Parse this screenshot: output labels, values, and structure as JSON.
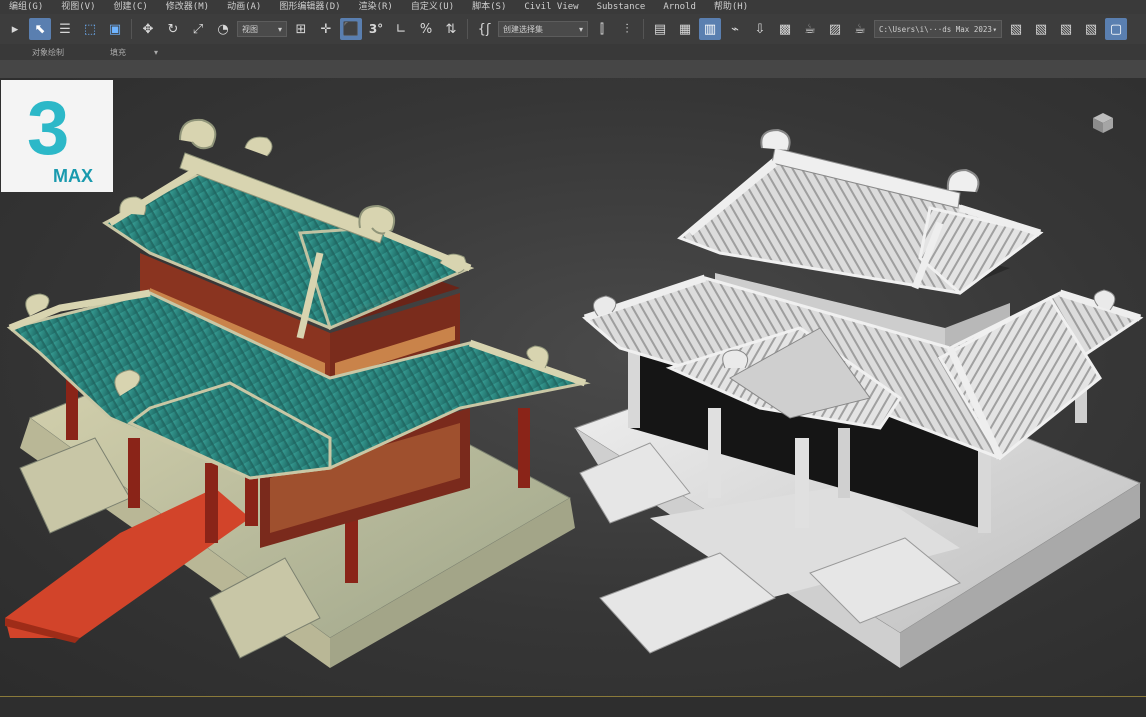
{
  "menu": {
    "items": [
      "编组(G)",
      "视图(V)",
      "创建(C)",
      "修改器(M)",
      "动画(A)",
      "图形编辑器(D)",
      "渲染(R)",
      "自定义(U)",
      "脚本(S)",
      "Civil View",
      "Substance",
      "Arnold",
      "帮助(H)"
    ]
  },
  "toolbar": {
    "view_dropdown": "视图",
    "selection_set_dropdown": "创建选择集",
    "angle_snap_label": "3°",
    "path_text": "C:\\Users\\i\\···ds Max 2023"
  },
  "ribbon": {
    "object_paint": "对象绘制",
    "fill": "填充",
    "extra": "▾"
  },
  "logo": {
    "number": "3",
    "text": "MAX"
  },
  "colors": {
    "accent": "#5a7fb0",
    "teal_roof": "#2f8a84",
    "logo_teal": "#2cb8c8",
    "carpet": "#d2442a"
  }
}
